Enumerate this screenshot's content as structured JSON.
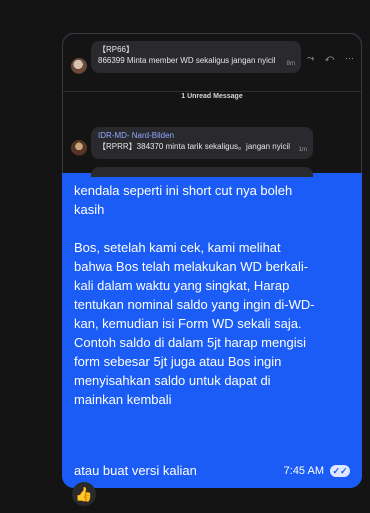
{
  "preview": {
    "quote1": {
      "sender": "【RP66】",
      "text": "866399 Minta member WD sekaligus jangan nyicil",
      "time": "8m"
    },
    "quote_actions": "⤳ ↶ ⋯",
    "unread_label": "1 Unread Message",
    "quote2": {
      "sender": "IDR-MD- Nard-Bilden",
      "text": "【RPRR】384370 minta tarik sekaligus。jangan nyicil",
      "time": "1m"
    }
  },
  "message": {
    "body": "kendala seperti ini short cut nya boleh\nkasih\n\nBos, setelah kami cek, kami melihat\nbahwa Bos telah melakukan WD berkali-\nkali dalam waktu yang singkat, Harap\ntentukan nominal saldo yang ingin di-WD-\nkan, kemudian isi Form WD sekali saja.\nContoh saldo di dalam 5jt harap mengisi\nform sebesar 5jt juga atau Bos ingin\nmenyisahkan saldo untuk dapat di\nmainkan kembali",
    "footer": "atau buat versi kalian",
    "time": "7:45 AM",
    "read_status_icon": "double-check-icon"
  },
  "reaction": "👍",
  "colors": {
    "background": "#141414",
    "bubble": "#1a5cf5",
    "quote_bg": "#2a2a2e",
    "sender_blue": "#8fa8ff"
  }
}
